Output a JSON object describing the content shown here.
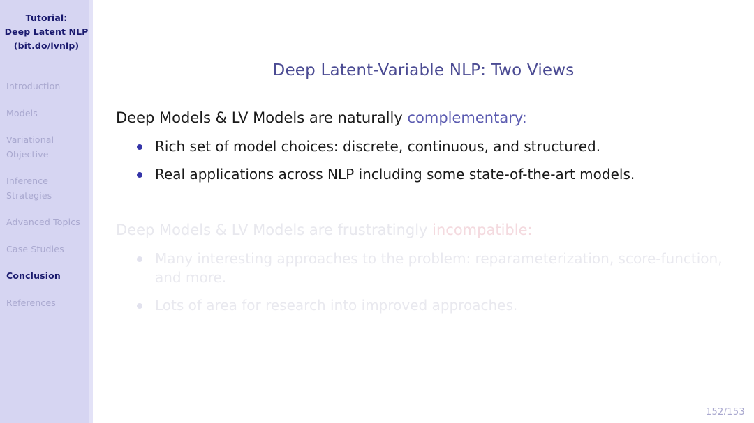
{
  "sidebar": {
    "title_lines": [
      "Tutorial:",
      "Deep Latent NLP",
      "(bit.do/lvnlp)"
    ],
    "items": [
      {
        "label": "Introduction",
        "active": false
      },
      {
        "label": "Models",
        "active": false
      },
      {
        "label": "Variational Objective",
        "active": false
      },
      {
        "label": "Inference Strategies",
        "active": false
      },
      {
        "label": "Advanced Topics",
        "active": false
      },
      {
        "label": "Case Studies",
        "active": false
      },
      {
        "label": "Conclusion",
        "active": true
      },
      {
        "label": "References",
        "active": false
      }
    ]
  },
  "slide": {
    "title": "Deep Latent-Variable NLP: Two Views",
    "visible_block": {
      "lead_prefix": "Deep Models & LV Models are naturally ",
      "lead_accent": "complementary:",
      "bullets": [
        "Rich set of model choices: discrete, continuous, and structured.",
        "Real applications across NLP including some state-of-the-art models."
      ]
    },
    "faded_block": {
      "lead_prefix": "Deep Models & LV Models are frustratingly ",
      "lead_accent": "incompatible:",
      "bullets": [
        "Many interesting approaches to the problem: reparameterization, score-function, and more.",
        "Lots of area for research into improved approaches."
      ]
    },
    "page_number": "152/153"
  },
  "colors": {
    "sidebar_bg": "#d6d5f2",
    "sidebar_active": "#1a1a6e",
    "sidebar_inactive": "#a9a8cf",
    "title": "#4b4b93",
    "accent_purple": "#5b5bb0",
    "accent_red_faded": "#f4dadf",
    "bullet": "#3434a8",
    "body_text": "#1a1a1a",
    "faded_text": "#e8e8ee"
  }
}
